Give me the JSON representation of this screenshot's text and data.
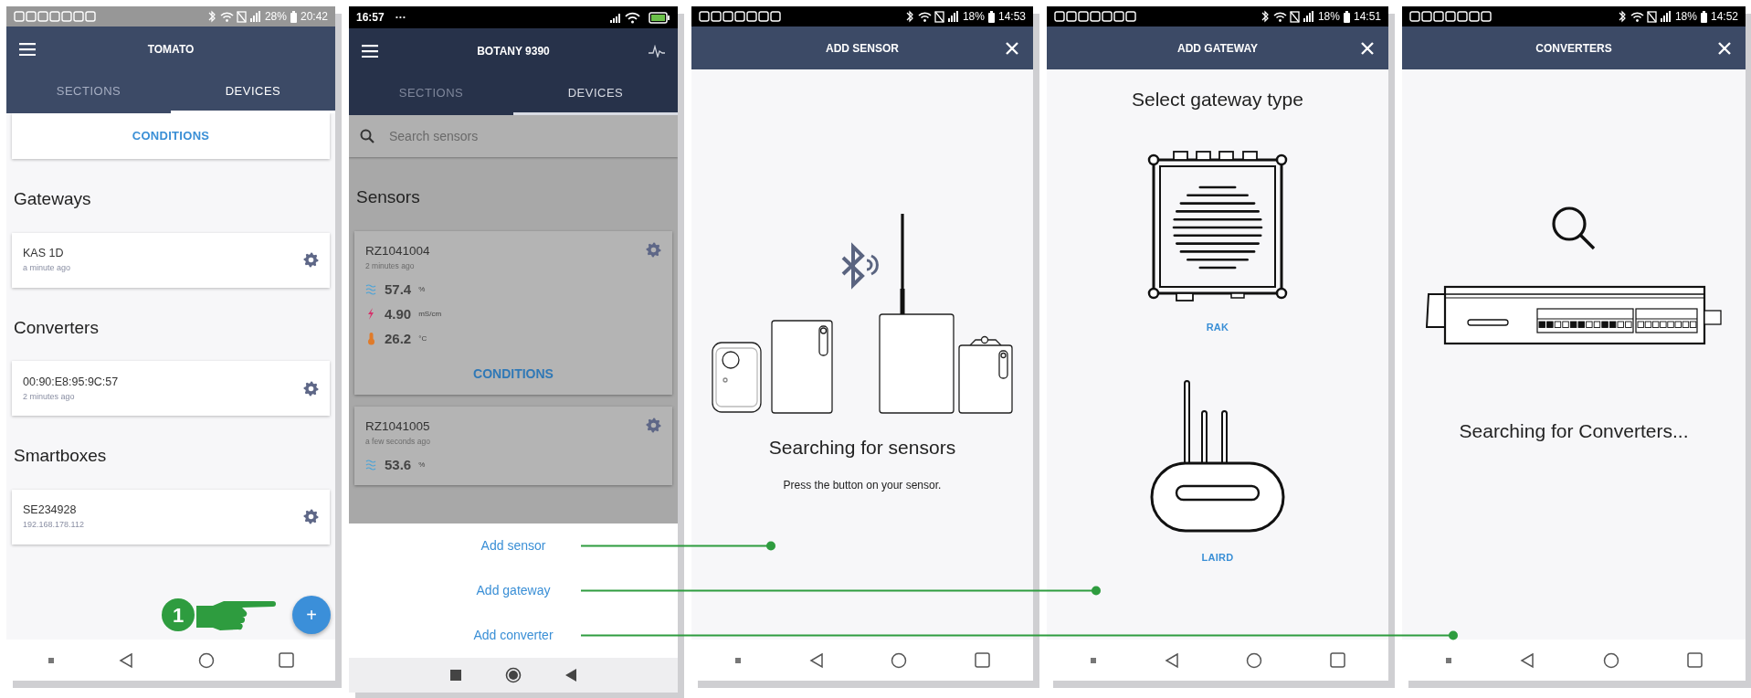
{
  "phones": [
    {
      "kind": "devices",
      "status_bar": {
        "kind": "gray",
        "battery": "28%",
        "time": "20:42"
      },
      "header": {
        "title": "TOMATO"
      },
      "tabs": [
        {
          "label": "SECTIONS",
          "selected": false
        },
        {
          "label": "DEVICES",
          "selected": true
        }
      ],
      "conditions": "CONDITIONS",
      "sections": [
        {
          "heading": "Gateways",
          "devices": [
            {
              "name": "KAS 1D",
              "subtitle": "a minute ago"
            }
          ]
        },
        {
          "heading": "Converters",
          "devices": [
            {
              "name": "00:90:E8:95:9C:57",
              "subtitle": "2 minutes ago"
            }
          ]
        },
        {
          "heading": "Smartboxes",
          "devices": [
            {
              "name": "SE234928",
              "subtitle": "192.168.178.112"
            }
          ]
        }
      ],
      "fab": "+",
      "step": "1",
      "nav_bar": {
        "kind": "samsung"
      }
    },
    {
      "kind": "sensors",
      "sheet_open": true,
      "status_bar": {
        "kind": "xiaomi",
        "time": "16:57",
        "extra": "···"
      },
      "header": {
        "title": "BOTANY 9390"
      },
      "tabs": [
        {
          "label": "SECTIONS",
          "selected": false
        },
        {
          "label": "DEVICES",
          "selected": true
        }
      ],
      "search": {
        "placeholder": "Search sensors"
      },
      "heading": "Sensors",
      "sensors": [
        {
          "name": "RZ1041004",
          "subtitle": "2 minutes ago",
          "readings": [
            {
              "kind": "moisture",
              "value": "57.4",
              "unit": "%"
            },
            {
              "kind": "conductivity",
              "value": "4.90",
              "unit": "mS/cm"
            },
            {
              "kind": "temperature",
              "value": "26.2",
              "unit": "°C"
            }
          ],
          "conditions": "CONDITIONS"
        },
        {
          "name": "RZ1041005",
          "subtitle": "a few seconds ago",
          "readings": [
            {
              "kind": "moisture",
              "value": "53.6",
              "unit": "%"
            }
          ]
        }
      ],
      "sheet": [
        "Add sensor",
        "Add gateway",
        "Add converter"
      ],
      "nav_bar": {
        "kind": "xiaomi"
      }
    },
    {
      "kind": "add_sensor",
      "status_bar": {
        "kind": "black",
        "battery": "18%",
        "time": "14:53"
      },
      "header": {
        "title": "ADD SENSOR"
      },
      "heading": "Searching for sensors",
      "message": "Press the button on your sensor.",
      "nav_bar": {
        "kind": "samsung"
      }
    },
    {
      "kind": "add_gateway",
      "status_bar": {
        "kind": "black",
        "battery": "18%",
        "time": "14:51"
      },
      "header": {
        "title": "ADD GATEWAY"
      },
      "heading": "Select gateway type",
      "options": [
        {
          "kind": "rak",
          "label": "RAK"
        },
        {
          "kind": "laird",
          "label": "LAIRD"
        }
      ],
      "nav_bar": {
        "kind": "samsung"
      }
    },
    {
      "kind": "converters",
      "status_bar": {
        "kind": "black",
        "battery": "18%",
        "time": "14:52"
      },
      "header": {
        "title": "CONVERTERS"
      },
      "heading": "Searching for Converters...",
      "nav_bar": {
        "kind": "samsung"
      }
    }
  ]
}
